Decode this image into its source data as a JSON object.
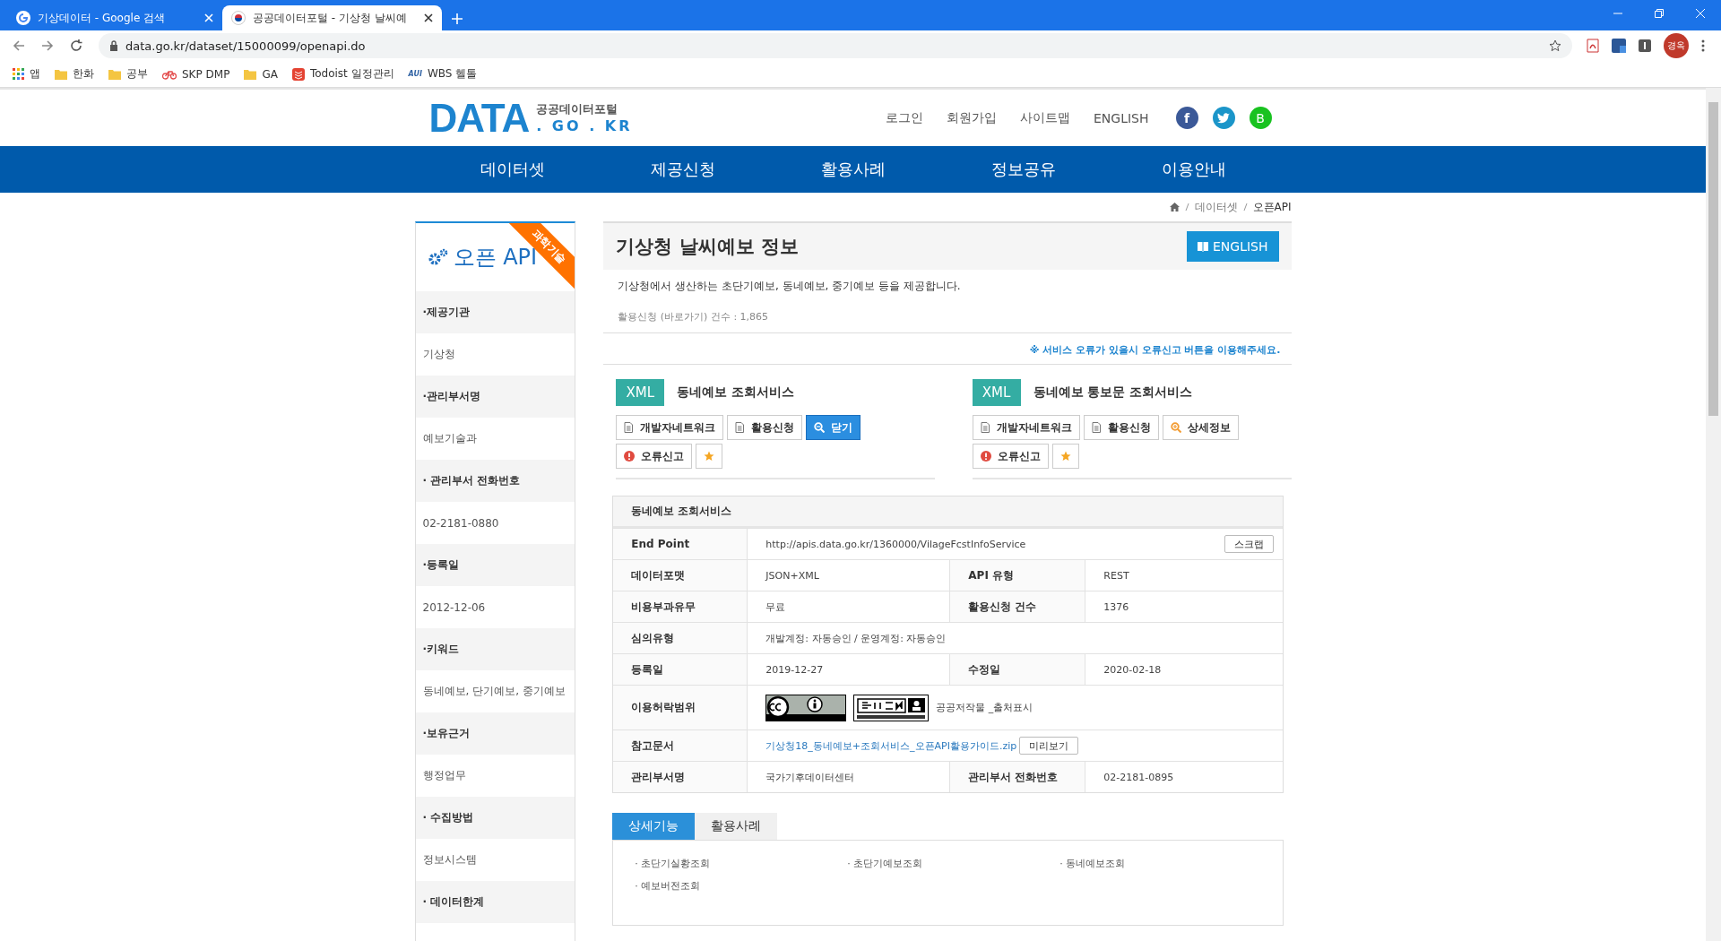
{
  "browser": {
    "tabs": [
      {
        "title": "기상데이터 - Google 검색",
        "kind": "google",
        "selected": false
      },
      {
        "title": "공공데이터포털 - 기상청 날씨예",
        "kind": "flag",
        "selected": true
      }
    ],
    "url": "data.go.kr/dataset/15000099/openapi.do",
    "profile": "경옥",
    "bookmarks": [
      {
        "kind": "apps",
        "label": "앱"
      },
      {
        "kind": "folder",
        "label": "한화"
      },
      {
        "kind": "folder",
        "label": "공부"
      },
      {
        "kind": "bike",
        "label": "SKP DMP"
      },
      {
        "kind": "folder",
        "label": "GA"
      },
      {
        "kind": "todoist",
        "label": "Todoist 일정관리"
      },
      {
        "kind": "aui",
        "badge": "AUI",
        "label": "WBS 헬톨"
      }
    ]
  },
  "header": {
    "logo": "DATA",
    "logo_title": "공공데이터포털",
    "logo_domain": ". GO . KR",
    "links": [
      "로그인",
      "회원가입",
      "사이트맵",
      "ENGLISH"
    ],
    "social": [
      {
        "kind": "facebook",
        "label": "f"
      },
      {
        "kind": "twitter"
      },
      {
        "kind": "band",
        "label": "B"
      }
    ]
  },
  "nav": [
    "데이터셋",
    "제공신청",
    "활용사례",
    "정보공유",
    "이용안내"
  ],
  "breadcrumb": [
    "데이터셋",
    "오픈API"
  ],
  "sidebar": {
    "title": "오픈 API",
    "ribbon": "과학기술",
    "fields": [
      {
        "label": "·제공기관",
        "value": "기상청"
      },
      {
        "label": "·관리부서명",
        "value": "예보기술과"
      },
      {
        "label": "· 관리부서 전화번호",
        "value": "02-2181-0880"
      },
      {
        "label": "·등록일",
        "value": "2012-12-06"
      },
      {
        "label": "·키워드",
        "value": "동네예보, 단기예보, 중기예보"
      },
      {
        "label": "·보유근거",
        "value": "행정업무"
      },
      {
        "label": "· 수집방법",
        "value": "정보시스템"
      },
      {
        "label": "· 데이터한계"
      }
    ]
  },
  "main": {
    "title": "기상청 날씨예보 정보",
    "english_button": "ENGLISH",
    "description": "기상청에서 생산하는 초단기예보, 동네예보, 중기예보 등을 제공합니다.",
    "count": "활용신청 (바로가기) 건수 : 1,865",
    "notice": "※ 서비스 오류가 있을시 오류신고 버튼을 이용해주세요.",
    "services": [
      {
        "format": "XML",
        "name": "동네예보 조회서비스",
        "buttons": [
          {
            "kind": "doc",
            "label": "개발자네트워크"
          },
          {
            "kind": "doc",
            "label": "활용신청"
          },
          {
            "kind": "toggle",
            "label": "닫기",
            "selected": true
          }
        ],
        "report": "오류신고",
        "favorite": false
      },
      {
        "format": "XML",
        "name": "동네예보 통보문 조회서비스",
        "buttons": [
          {
            "kind": "doc",
            "label": "개발자네트워크"
          },
          {
            "kind": "doc",
            "label": "활용신청"
          },
          {
            "kind": "toggle",
            "label": "상세정보",
            "selected": false
          }
        ],
        "report": "오류신고",
        "favorite": false
      }
    ],
    "detail": {
      "title": "동네예보 조회서비스",
      "rows": [
        {
          "kind": "endpoint",
          "label": "End Point",
          "value": "http://apis.data.go.kr/1360000/VilageFcstInfoService",
          "button": "스크랩"
        },
        {
          "kind": "pair",
          "label": "데이터포맷",
          "value": "JSON+XML",
          "label2": "API 유형",
          "value2": "REST"
        },
        {
          "kind": "pair",
          "label": "비용부과유무",
          "value": "무료",
          "label2": "활용신청 건수",
          "value2": "1376"
        },
        {
          "kind": "single",
          "label": "심의유형",
          "value": "개발계정: 자동승인 / 운영계정: 자동승인"
        },
        {
          "kind": "pair",
          "label": "등록일",
          "value": "2019-12-27",
          "label2": "수정일",
          "value2": "2020-02-18"
        },
        {
          "kind": "license",
          "label": "이용허락범위",
          "value": "공공저작물 _출처표시"
        },
        {
          "kind": "document",
          "label": "참고문서",
          "value": "기상청18_동네예보+조회서비스_오픈API활용가이드.zip",
          "button": "미리보기"
        },
        {
          "kind": "pair",
          "label": "관리부서명",
          "value": "국가기후데이터센터",
          "label2": "관리부서 전화번호",
          "value2": "02-2181-0895"
        }
      ]
    },
    "tabs": [
      {
        "label": "상세기능",
        "selected": true
      },
      {
        "label": "활용사례",
        "selected": false
      }
    ],
    "features": [
      "· 초단기실황조회",
      "· 초단기예보조회",
      "· 동네예보조회",
      "· 예보버전조회"
    ]
  }
}
